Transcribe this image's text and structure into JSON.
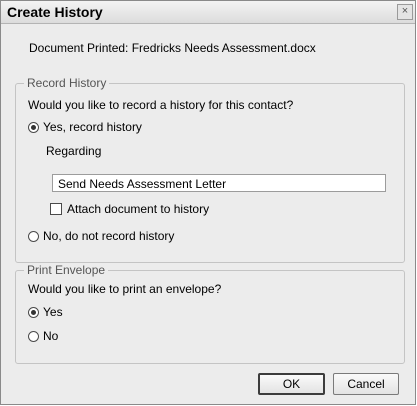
{
  "window": {
    "title": "Create History",
    "close_glyph": "×"
  },
  "document_line": "Document Printed: Fredricks Needs Assessment.docx",
  "record_history": {
    "group_label": "Record History",
    "question": "Would you like to record a history for this contact?",
    "option_yes": "Yes, record history",
    "regarding_label": "Regarding",
    "regarding_value": "Send Needs Assessment Letter",
    "attach_label": "Attach document to history",
    "option_no": "No, do not record history",
    "selected": "yes"
  },
  "print_envelope": {
    "group_label": "Print Envelope",
    "question": "Would you like to print an envelope?",
    "option_yes": "Yes",
    "option_no": "No",
    "selected": "yes"
  },
  "buttons": {
    "ok": "OK",
    "cancel": "Cancel"
  }
}
